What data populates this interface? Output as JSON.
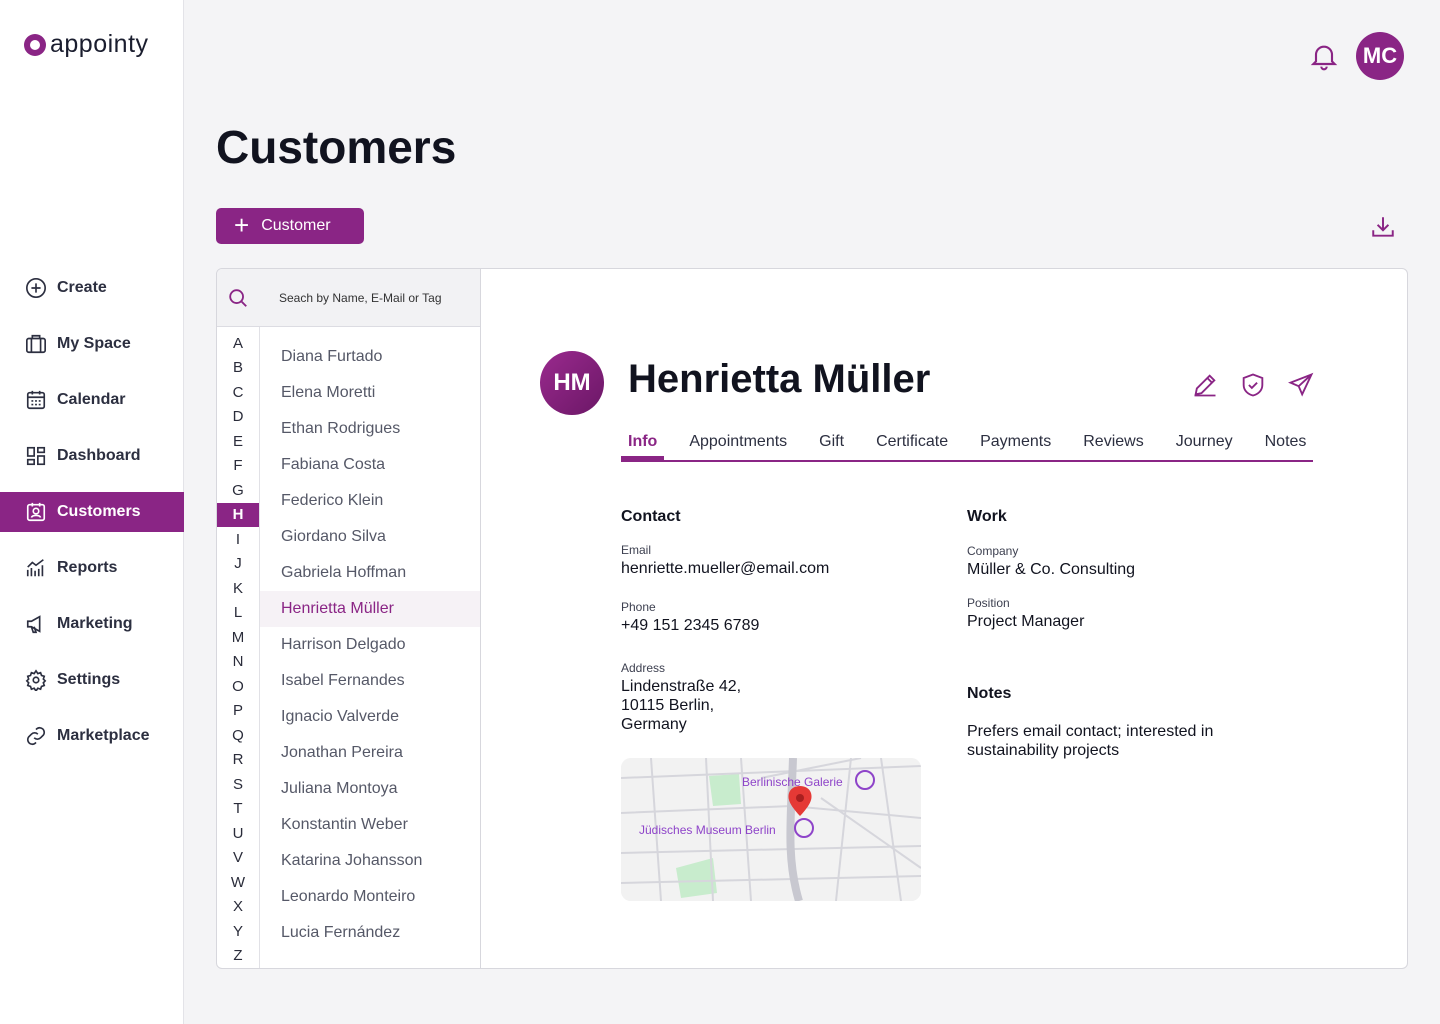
{
  "app": {
    "logo_text": "appointy"
  },
  "sidebar": {
    "items": [
      {
        "label": "Create",
        "icon": "plus-circle-icon"
      },
      {
        "label": "My Space",
        "icon": "briefcase-icon"
      },
      {
        "label": "Calendar",
        "icon": "calendar-icon"
      },
      {
        "label": "Dashboard",
        "icon": "dashboard-icon"
      },
      {
        "label": "Customers",
        "icon": "customer-icon",
        "active": true
      },
      {
        "label": "Reports",
        "icon": "reports-icon"
      },
      {
        "label": "Marketing",
        "icon": "megaphone-icon"
      },
      {
        "label": "Settings",
        "icon": "gear-icon"
      },
      {
        "label": "Marketplace",
        "icon": "link-icon"
      }
    ]
  },
  "header": {
    "user_initials": "MC"
  },
  "page": {
    "title": "Customers",
    "add_button_label": "Customer"
  },
  "search": {
    "placeholder": "Seach by Name, E-Mail or Tag"
  },
  "alphabet": [
    "A",
    "B",
    "C",
    "D",
    "E",
    "F",
    "G",
    "H",
    "I",
    "J",
    "K",
    "L",
    "M",
    "N",
    "O",
    "P",
    "Q",
    "R",
    "S",
    "T",
    "U",
    "V",
    "W",
    "X",
    "Y",
    "Z"
  ],
  "alphabet_active": "H",
  "customers": [
    "Diana Furtado",
    "Elena Moretti",
    "Ethan Rodrigues",
    "Fabiana Costa",
    "Federico Klein",
    "Giordano Silva",
    "Gabriela Hoffman",
    "Henrietta Müller",
    "Harrison Delgado",
    "Isabel Fernandes",
    "Ignacio Valverde",
    "Jonathan Pereira",
    "Juliana Montoya",
    "Konstantin Weber",
    "Katarina Johansson",
    "Leonardo Monteiro",
    "Lucia Fernández"
  ],
  "customers_active": "Henrietta Müller",
  "detail": {
    "initials": "HM",
    "name": "Henrietta Müller",
    "tabs": [
      "Info",
      "Appointments",
      "Gift",
      "Certificate",
      "Payments",
      "Reviews",
      "Journey",
      "Notes"
    ],
    "active_tab": "Info",
    "contact": {
      "title": "Contact",
      "email_label": "Email",
      "email": "henriette.mueller@email.com",
      "phone_label": "Phone",
      "phone": "+49 151 2345 6789",
      "address_label": "Address",
      "address_line1": "Lindenstraße 42,",
      "address_line2": "10115 Berlin,",
      "address_line3": "Germany"
    },
    "work": {
      "title": "Work",
      "company_label": "Company",
      "company": "Müller & Co. Consulting",
      "position_label": "Position",
      "position": "Project Manager"
    },
    "notes": {
      "title": "Notes",
      "line1": "Prefers email contact; interested in",
      "line2": "sustainability projects"
    },
    "map": {
      "place1": "Berlinische Galerie",
      "place2": "Jüdisches Museum Berlin"
    }
  },
  "colors": {
    "accent": "#8a2585",
    "marker": "#e53935",
    "poi": "#8e44c9",
    "park": "#c8eccd"
  }
}
